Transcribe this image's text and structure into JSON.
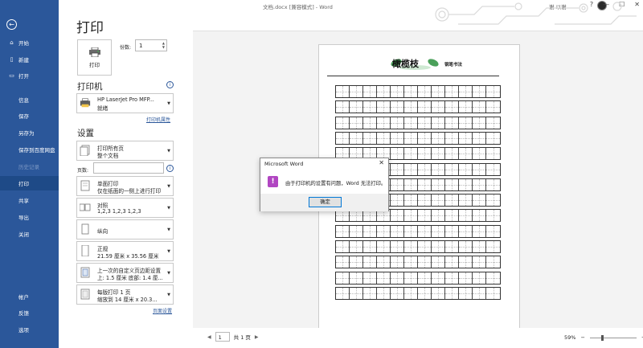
{
  "titlebar": {
    "doc_title": "文档.docx [兼容模式] - Word",
    "user": "谢 以谢",
    "buttons": [
      "?",
      "—",
      "☐",
      "✕"
    ]
  },
  "sidebar": {
    "back_icon": "back-arrow-icon",
    "items": [
      {
        "label": "开始",
        "icon": "⌂"
      },
      {
        "label": "新建",
        "icon": "🗋"
      },
      {
        "label": "打开",
        "icon": "🗀"
      },
      {
        "label": "信息"
      },
      {
        "label": "保存"
      },
      {
        "label": "另存为"
      },
      {
        "label": "保存到百度网盘"
      },
      {
        "label": "历史记录"
      },
      {
        "label": "打印"
      },
      {
        "label": "共享"
      },
      {
        "label": "导出"
      },
      {
        "label": "关闭"
      },
      {
        "label": "帐户"
      },
      {
        "label": "反馈"
      },
      {
        "label": "选项"
      }
    ]
  },
  "print": {
    "title": "打印",
    "button_label": "打印",
    "copies_label": "份数:",
    "copies_value": "1"
  },
  "printer": {
    "heading": "打印机",
    "name": "HP LaserJet Pro MFP...",
    "status": "就绪",
    "properties_link": "打印机属性"
  },
  "settings": {
    "heading": "设置",
    "pages_label": "页数:",
    "page_setup_link": "页面设置",
    "dropdowns": [
      {
        "l1": "打印所有页",
        "l2": "整个文档"
      },
      {
        "l1": "单面打印",
        "l2": "仅在纸面的一侧上进行打印"
      },
      {
        "l1": "对照",
        "l2": "1,2,3     1,2,3     1,2,3"
      },
      {
        "l1": "纵向",
        "l2": ""
      },
      {
        "l1": "正规",
        "l2": "21.59 厘米 x 35.56 厘米"
      },
      {
        "l1": "上一次的自定义页边距设置",
        "l2": "上: 1.5 厘米 底部: 1.4 厘..."
      },
      {
        "l1": "每版打印 1 页",
        "l2": "缩放到 14 厘米 x 20.3..."
      }
    ]
  },
  "preview": {
    "header_title": "橄榄枝",
    "header_sub": "钢笔书法",
    "grid_rows": 14,
    "grid_cols": 12
  },
  "statusbar": {
    "page_current": "1",
    "page_total": "共 1 页",
    "zoom": "59%",
    "zoom_minus": "−",
    "zoom_plus": "+"
  },
  "dialog": {
    "title": "Microsoft Word",
    "message": "由于打印机的设置有问题，Word 无法打印。",
    "ok": "确定",
    "accent": "#b146c2"
  },
  "colors": {
    "sidebar": "#2b579a",
    "active": "#1e4a87"
  }
}
